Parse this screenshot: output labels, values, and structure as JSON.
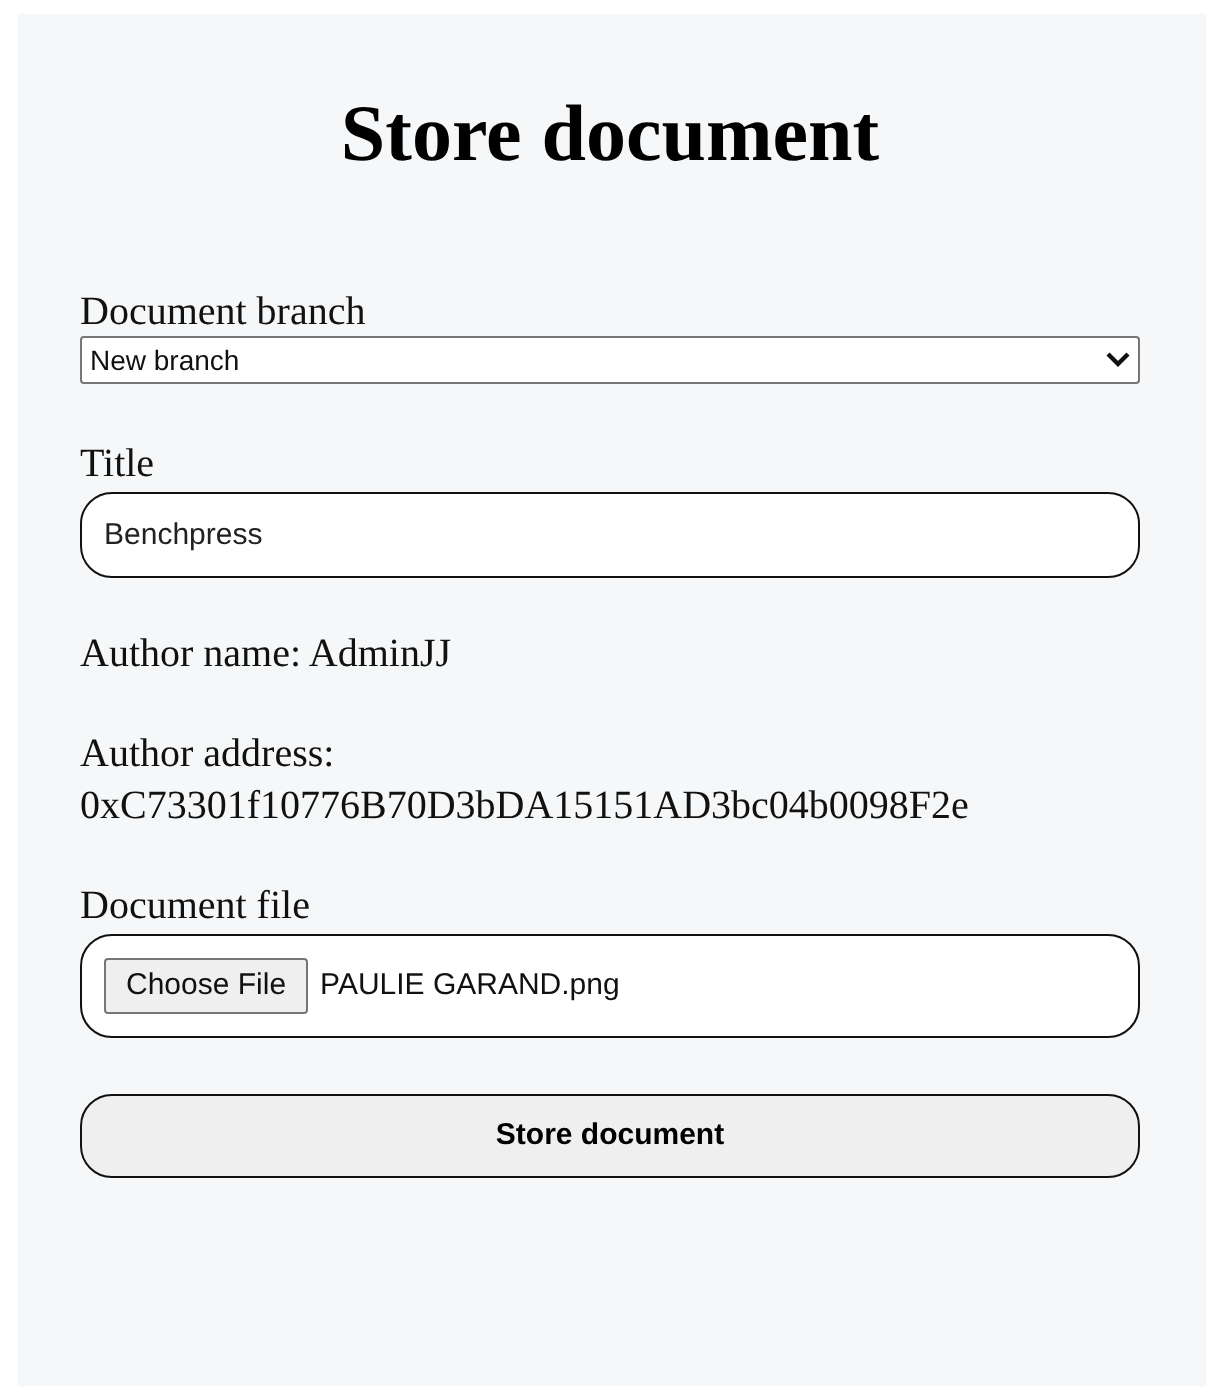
{
  "heading": "Store document",
  "branch": {
    "label": "Document branch",
    "value": "New branch"
  },
  "title_field": {
    "label": "Title",
    "value": "Benchpress"
  },
  "author_name": "Author name: AdminJJ",
  "author_address": {
    "label": "Author address:",
    "value": "0xC73301f10776B70D3bDA15151AD3bc04b0098F2e"
  },
  "file": {
    "label": "Document file",
    "button": "Choose File",
    "filename": "PAULIE GARAND.png"
  },
  "submit": "Store document"
}
